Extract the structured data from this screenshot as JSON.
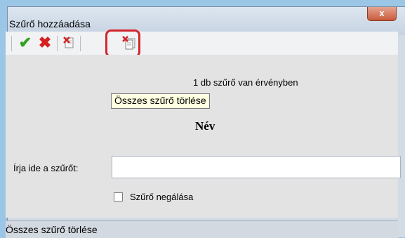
{
  "window": {
    "title": "Szűrő hozzáadása",
    "close_label": "x"
  },
  "toolbar": {
    "ok_icon": "checkmark-icon",
    "cancel_icon": "cross-icon",
    "delete_icon": "delete-filter-icon",
    "clear_all_icon": "clear-all-filters-icon",
    "highlight_color": "#d2262c"
  },
  "info": {
    "filter_count_text": "1 db szűrő van érvényben"
  },
  "tooltip": {
    "text": "Összes szűrő törlése"
  },
  "form": {
    "field_name": "Név",
    "input_label": "Írja ide a szűrőt:",
    "input_value": "",
    "negate_label": "Szűrő negálása",
    "negate_checked": false
  },
  "statusbar": {
    "text": "Összes szűrő törlése"
  }
}
